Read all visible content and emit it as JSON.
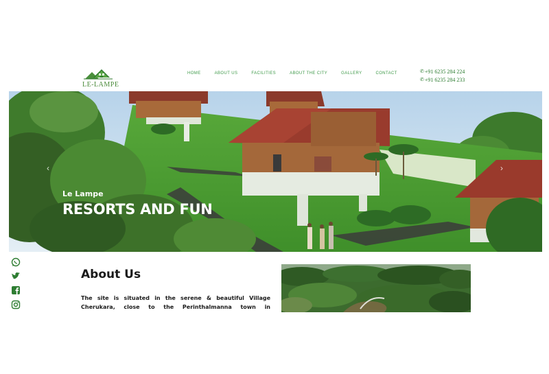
{
  "brand": {
    "name": "LE-LAMPE",
    "accent": "#3f9a4a"
  },
  "nav": {
    "items": [
      {
        "label": "HOME"
      },
      {
        "label": "ABOUT US"
      },
      {
        "label": "FACILITIES"
      },
      {
        "label": "ABOUT THE CITY"
      },
      {
        "label": "GALLERY"
      },
      {
        "label": "CONTACT"
      }
    ]
  },
  "contact": {
    "phones": [
      "+91 6235 284 224",
      "+91 6235 284 233"
    ],
    "icon": "phone-icon"
  },
  "hero": {
    "eyebrow": "Le Lampe",
    "headline": "RESORTS AND FUN",
    "prev_icon": "chevron-left-icon",
    "next_icon": "chevron-right-icon"
  },
  "social": {
    "items": [
      "whatsapp-icon",
      "twitter-icon",
      "facebook-icon",
      "instagram-icon"
    ]
  },
  "about": {
    "title": "About Us",
    "text": "The site is situated in the serene & beautiful Village Cherukara, close to the Perinthalmanna town in"
  }
}
